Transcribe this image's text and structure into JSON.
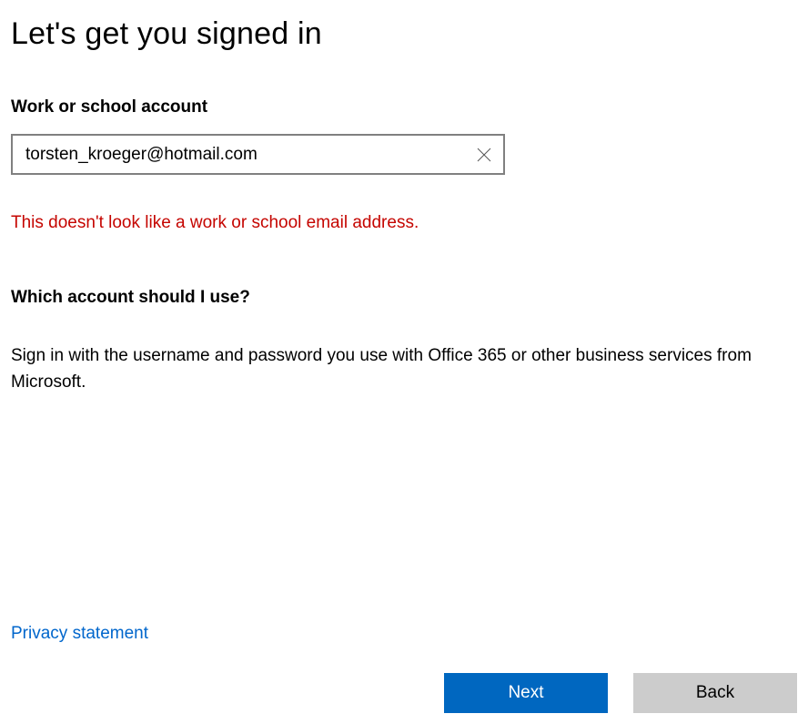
{
  "header": {
    "title": "Let's get you signed in"
  },
  "account_field": {
    "label": "Work or school account",
    "value": "torsten_kroeger@hotmail.com",
    "placeholder": ""
  },
  "error": {
    "message": "This doesn't look like a work or school email address."
  },
  "help": {
    "heading": "Which account should I use?",
    "body": "Sign in with the username and password you use with Office 365 or other business services from Microsoft."
  },
  "links": {
    "privacy": "Privacy statement"
  },
  "buttons": {
    "next": "Next",
    "back": "Back"
  },
  "colors": {
    "primary": "#0067c0",
    "error": "#c50500",
    "link": "#0066cc",
    "secondary_bg": "#cccccc"
  }
}
